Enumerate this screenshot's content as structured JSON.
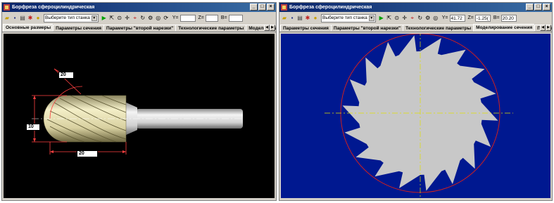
{
  "left_window": {
    "title": "Борфреза сфероцилиндрическая",
    "toolbar": {
      "machine_select": "Выберите тип станка"
    },
    "tabs": [
      "Основные размеры",
      "Параметры сечения",
      "Параметры \"второй нарезки\"",
      "Технологические параметры",
      "Моделирование с"
    ],
    "dimensions": {
      "angle_label": "20",
      "diameter_label": "10",
      "length_label": "20"
    },
    "colors": {
      "canvas": "#000000",
      "tool": "#efe8b8",
      "shank": "#e6e6e6",
      "dimension_lines": "#ff4040"
    }
  },
  "right_window": {
    "title": "Борфреза сфероцилиндрическая",
    "toolbar": {
      "machine_select": "Выберите тип станка",
      "y_label": "Y=",
      "y_value": "41.72",
      "z_label": "Z=",
      "z_value": "-1.25(",
      "b_label": "B=",
      "b_value": "20.20"
    },
    "tabs": [
      "Параметры сечения",
      "Параметры \"второй нарезки\"",
      "Технологические параметры",
      "Моделирование сечения",
      "Параметры в"
    ],
    "colors": {
      "canvas": "#001890",
      "section": "#c8c8c8",
      "circle": "#cc2020",
      "axis": "#e0e000"
    },
    "tooth_count": 18
  },
  "icons": [
    "open-icon",
    "save-icon",
    "print-icon",
    "tool-icon",
    "info-icon",
    "play-icon",
    "cursor-icon",
    "zoom-icon",
    "pan-icon",
    "axis-icon",
    "rotate-icon",
    "settings-icon"
  ]
}
